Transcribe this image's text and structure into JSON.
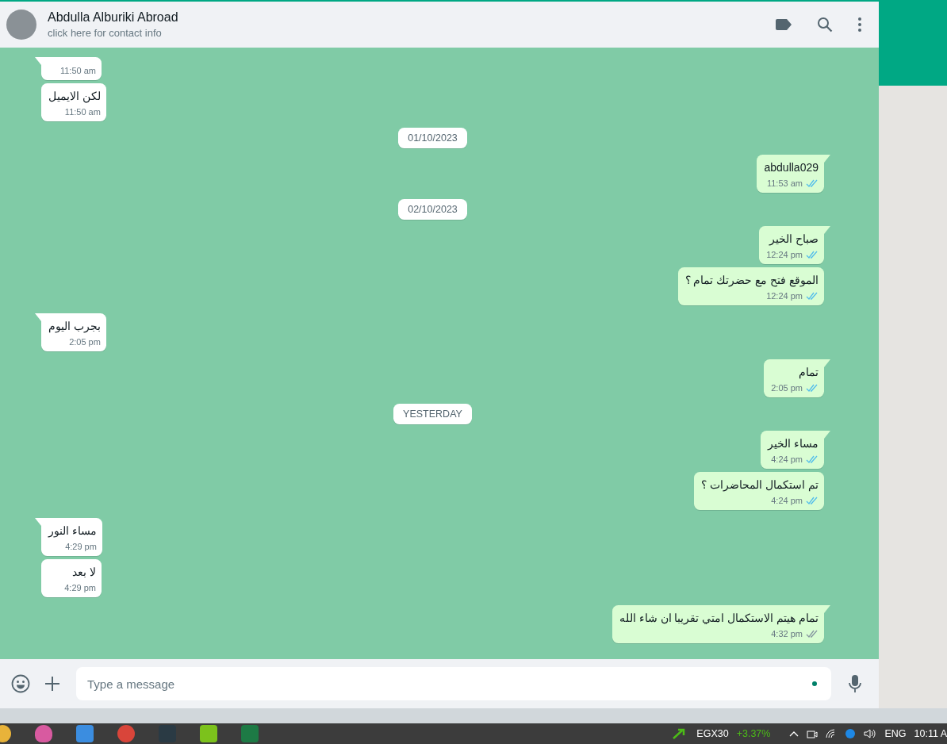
{
  "chat_header": {
    "name": "Abdulla Alburiki Abroad",
    "subtitle": "click here for contact info"
  },
  "messages": [
    {
      "kind": "incoming",
      "time": "11:50 am"
    },
    {
      "kind": "incoming",
      "text": "لكن الايميل",
      "time": "11:50 am"
    },
    {
      "kind": "date",
      "text": "01/10/2023"
    },
    {
      "kind": "outgoing",
      "text": "abdulla029",
      "time": "11:53 am",
      "read": true
    },
    {
      "kind": "date",
      "text": "02/10/2023"
    },
    {
      "kind": "outgoing",
      "text": "صباح الخير",
      "time": "12:24 pm",
      "read": true
    },
    {
      "kind": "outgoing",
      "text": "الموقع فتح مع حضرتك تمام ؟",
      "time": "12:24 pm",
      "read": true
    },
    {
      "kind": "incoming",
      "text": "بجرب اليوم",
      "time": "2:05 pm"
    },
    {
      "kind": "outgoing",
      "text": "تمام",
      "time": "2:05 pm",
      "read": true
    },
    {
      "kind": "date",
      "text": "YESTERDAY"
    },
    {
      "kind": "outgoing",
      "text": "مساء الخير",
      "time": "4:24 pm",
      "read": true
    },
    {
      "kind": "outgoing",
      "text": "تم استكمال المحاضرات ؟",
      "time": "4:24 pm",
      "read": true
    },
    {
      "kind": "incoming",
      "text": "مساء النور",
      "time": "4:29 pm"
    },
    {
      "kind": "incoming",
      "text": "لا بعد",
      "time": "4:29 pm"
    },
    {
      "kind": "outgoing",
      "text": "تمام هيتم الاستكمال امتي تقريبا ان شاء الله",
      "time": "4:32 pm",
      "read": false
    }
  ],
  "composer": {
    "placeholder": "Type a message"
  },
  "taskbar": {
    "ticker": "EGX30",
    "change": "+3.37%",
    "language": "ENG",
    "clock": "10:11 A"
  }
}
